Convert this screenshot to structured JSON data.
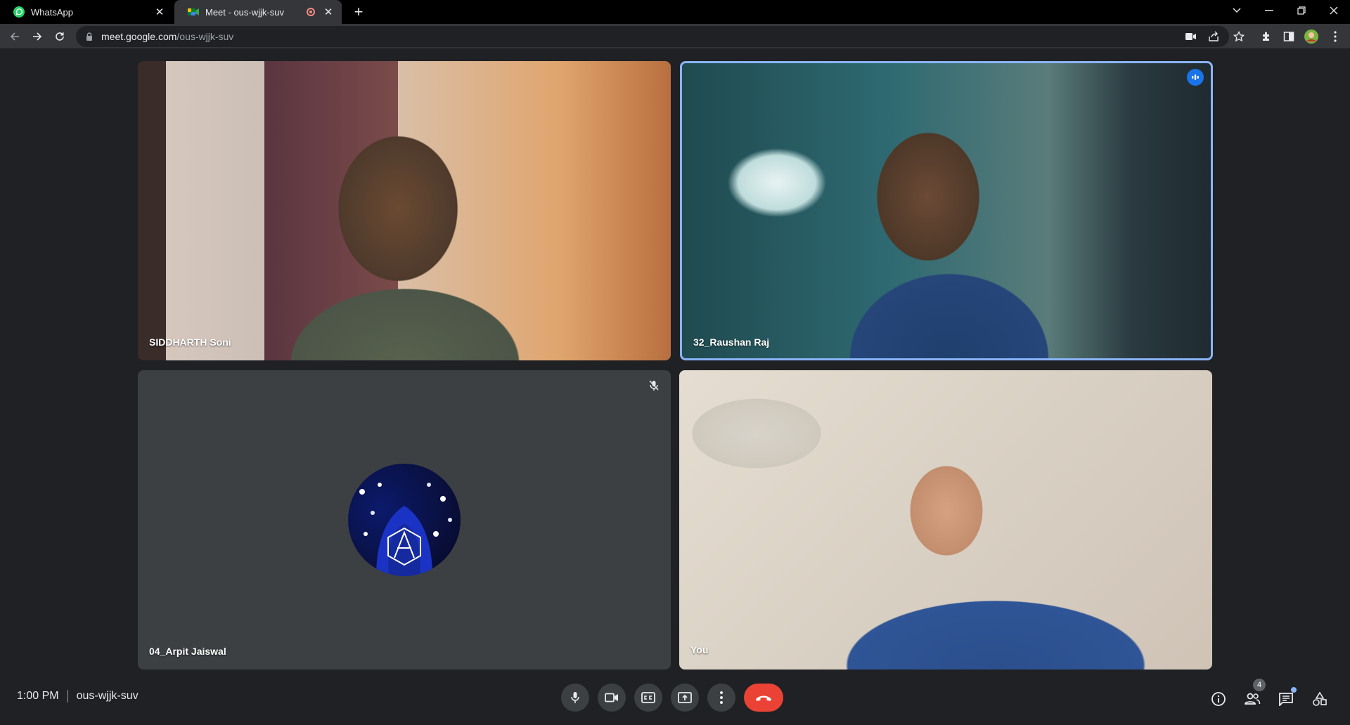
{
  "browser": {
    "tabs": [
      {
        "label": "WhatsApp",
        "icon": "whatsapp-icon"
      },
      {
        "label": "Meet - ous-wjjk-suv",
        "icon": "google-meet-icon",
        "recording": true
      }
    ],
    "url_host": "meet.google.com",
    "url_path": "/ous-wjjk-suv"
  },
  "participants": [
    {
      "name": "SIDDHARTH Soni"
    },
    {
      "name": "32_Raushan Raj",
      "speaking": true
    },
    {
      "name": "04_Arpit Jaiswal",
      "muted": true,
      "video_off": true
    },
    {
      "name": "You"
    }
  ],
  "meeting": {
    "time": "1:00 PM",
    "code": "ous-wjjk-suv",
    "people_count": "4"
  },
  "colors": {
    "accent": "#8ab4f8",
    "leave": "#ea4335",
    "background": "#202124",
    "control": "#3c4043"
  }
}
